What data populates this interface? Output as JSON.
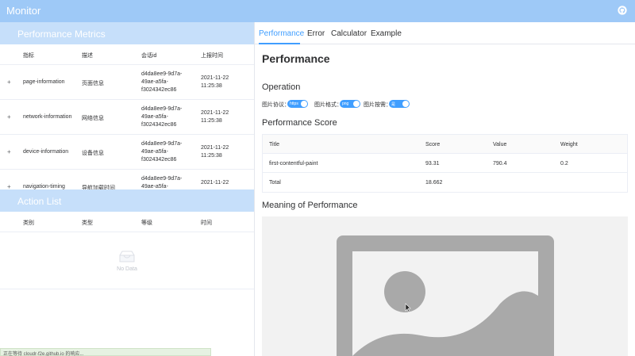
{
  "app": {
    "title": "Monitor"
  },
  "metrics": {
    "title": "Performance Metrics",
    "headers": [
      "指标",
      "描述",
      "会话id",
      "上报时间"
    ],
    "rows": [
      {
        "metric": "page-information",
        "desc": "页面信息",
        "sid1": "d4da8ee9-9d7a-",
        "sid2": "49ae-a5fa-",
        "sid3": "f3024342ec86",
        "t1": "2021-11-22",
        "t2": "11:25:38"
      },
      {
        "metric": "network-information",
        "desc": "网络信息",
        "sid1": "d4da8ee9-9d7a-",
        "sid2": "49ae-a5fa-",
        "sid3": "f3024342ec86",
        "t1": "2021-11-22",
        "t2": "11:25:38"
      },
      {
        "metric": "device-information",
        "desc": "设备信息",
        "sid1": "d4da8ee9-9d7a-",
        "sid2": "49ae-a5fa-",
        "sid3": "f3024342ec86",
        "t1": "2021-11-22",
        "t2": "11:25:38"
      },
      {
        "metric": "navigation-timing",
        "desc": "导航加载时间",
        "sid1": "d4da8ee9-9d7a-",
        "sid2": "49ae-a5fa-",
        "sid3": "",
        "t1": "2021-11-22",
        "t2": ""
      }
    ]
  },
  "actions": {
    "title": "Action List",
    "headers": [
      "类别",
      "类型",
      "等级",
      "时间"
    ],
    "empty_text": "No Data"
  },
  "status_bar": "正在等待 cloudr-f2e.github.io 的响应...",
  "tabs": [
    "Performance",
    "Error",
    "Calculator",
    "Example"
  ],
  "active_tab": 0,
  "page_title": "Performance",
  "operation": {
    "title": "Operation",
    "options": [
      {
        "label": "图片协议：",
        "value": "https"
      },
      {
        "label": "图片格式：",
        "value": "png"
      },
      {
        "label": "图片按需：",
        "value": "是"
      }
    ]
  },
  "score": {
    "title": "Performance Score",
    "headers": [
      "Title",
      "Score",
      "Value",
      "Weight"
    ],
    "rows": [
      [
        "first-contentful-paint",
        "93.31",
        "790.4",
        "0.2"
      ],
      [
        "Total",
        "18.662",
        "",
        ""
      ]
    ]
  },
  "meaning_title": "Meaning of Performance",
  "colors": {
    "header": "#9ec9f7",
    "section_header": "#c6dffa",
    "accent": "#409eff"
  },
  "icons": [
    "github-icon",
    "empty-box-icon",
    "image-placeholder-icon",
    "mouse-cursor-icon"
  ]
}
